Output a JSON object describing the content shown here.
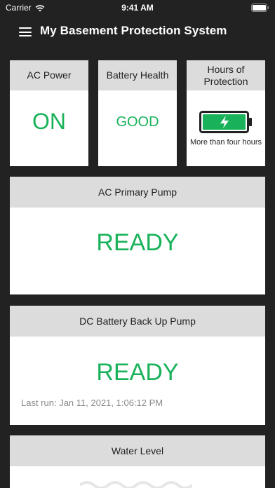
{
  "status": {
    "carrier": "Carrier",
    "time": "9:41 AM"
  },
  "nav": {
    "title": "My Basement Protection System"
  },
  "cards": {
    "ac_power": {
      "label": "AC Power",
      "value": "ON"
    },
    "battery_health": {
      "label": "Battery Health",
      "value": "GOOD"
    },
    "hours_protection": {
      "label": "Hours of Protection",
      "note": "More than four hours",
      "charge_fraction": 1.0
    },
    "ac_pump": {
      "label": "AC Primary Pump",
      "value": "READY"
    },
    "dc_pump": {
      "label": "DC Battery Back Up Pump",
      "value": "READY",
      "last_run": "Last run: Jan 11, 2021, 1:06:12 PM"
    },
    "water_level": {
      "label": "Water Level"
    }
  },
  "colors": {
    "background": "#222222",
    "card": "#ffffff",
    "card_header": "#dcdcdc",
    "status_green": "#19b25a",
    "secondary_text": "#8a8a8a"
  },
  "icons": [
    "wifi-icon",
    "battery-status-icon",
    "menu-icon",
    "charging-battery-icon",
    "water-wave-icon"
  ]
}
